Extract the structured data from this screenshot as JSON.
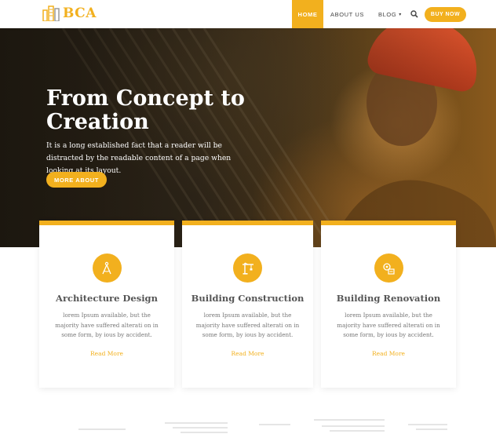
{
  "brand": {
    "name": "BCA",
    "accent": "#f2b01e"
  },
  "nav": {
    "items": [
      {
        "label": "HOME",
        "active": true
      },
      {
        "label": "ABOUT US",
        "active": false
      },
      {
        "label": "BLOG",
        "active": false,
        "has_dropdown": true
      }
    ],
    "search_icon": "search-icon",
    "buy_label": "BUY NOW"
  },
  "hero": {
    "title": "From Concept to Creation",
    "text": "It is a long established fact that a reader will be distracted by the readable content of a page when looking at its layout.",
    "button_label": "MORE ABOUT"
  },
  "cards": [
    {
      "icon": "compass-drafting-icon",
      "title": "Architecture Design",
      "text": "lorem Ipsum available, but the majority have suffered alterati on in some form, by ious by accident.",
      "link": "Read More"
    },
    {
      "icon": "crane-icon",
      "title": "Building Construction",
      "text": "lorem Ipsum available, but the majority have suffered alterati on in some form, by ious by accident.",
      "link": "Read More"
    },
    {
      "icon": "renovation-tools-icon",
      "title": "Building Renovation",
      "text": "lorem Ipsum available, but the majority have suffered alterati on in some form, by ious by accident.",
      "link": "Read More"
    }
  ]
}
